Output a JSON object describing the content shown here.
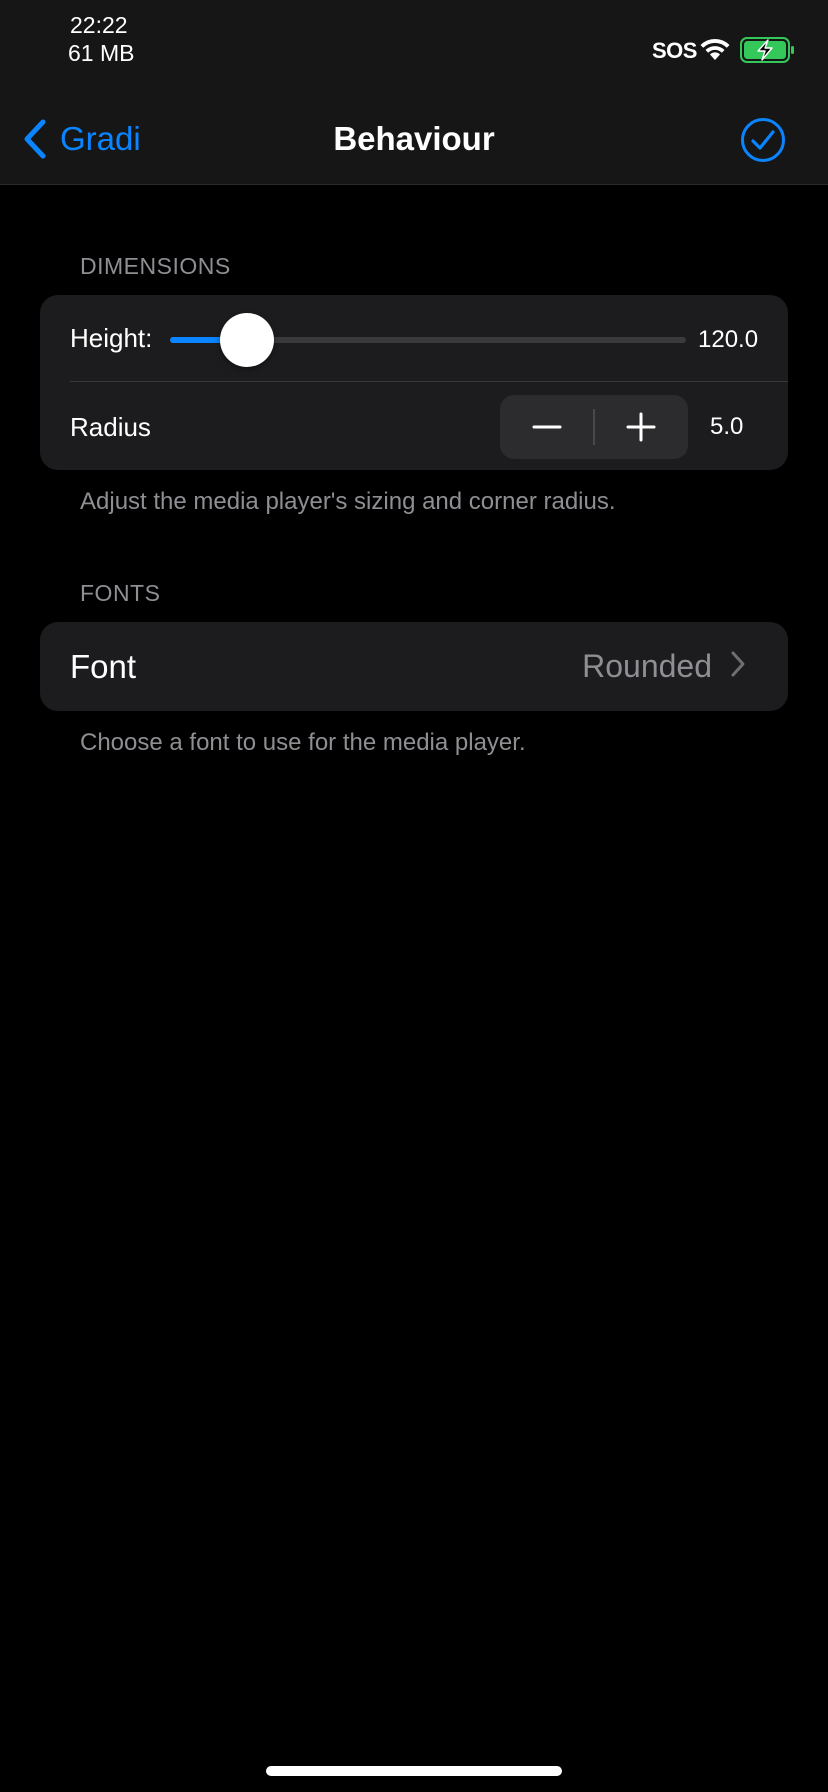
{
  "status_bar": {
    "time": "22:22",
    "memory": "61 MB",
    "carrier": "SOS"
  },
  "nav": {
    "back_label": "Gradi",
    "title": "Behaviour"
  },
  "dimensions": {
    "header": "DIMENSIONS",
    "height_label": "Height:",
    "height_value": "120.0",
    "height_slider_fraction": 0.15,
    "radius_label": "Radius",
    "radius_value": "5.0",
    "footer": "Adjust the media player's sizing and corner radius."
  },
  "fonts": {
    "header": "FONTS",
    "font_label": "Font",
    "font_value": "Rounded",
    "footer": "Choose a font to use for the media player."
  },
  "colors": {
    "accent": "#0a84ff",
    "background": "#000000",
    "card": "#1c1c1e",
    "secondary_text": "#8e8e93",
    "battery_green": "#34c759"
  },
  "icons": {
    "back": "chevron-left-icon",
    "done": "checkmark-circle-icon",
    "wifi": "wifi-icon",
    "battery": "battery-charging-icon",
    "minus": "minus-icon",
    "plus": "plus-icon",
    "disclosure": "chevron-right-icon"
  }
}
